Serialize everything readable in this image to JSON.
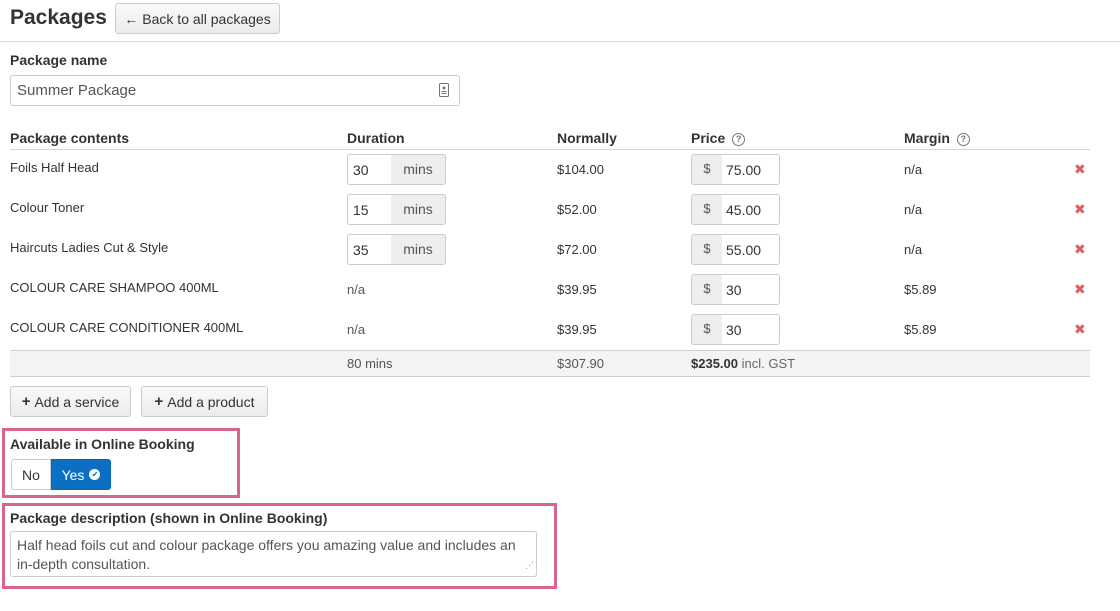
{
  "header": {
    "title": "Packages",
    "back_label": "Back to all packages"
  },
  "package_name": {
    "label": "Package name",
    "value": "Summer Package"
  },
  "table": {
    "headers": {
      "contents": "Package contents",
      "duration": "Duration",
      "normally": "Normally",
      "price": "Price",
      "margin": "Margin"
    },
    "rows": [
      {
        "name": "Foils Half Head",
        "duration": "30",
        "duration_unit": "mins",
        "normally": "$104.00",
        "currency": "$",
        "price": "75.00",
        "margin": "n/a"
      },
      {
        "name": "Colour Toner",
        "duration": "15",
        "duration_unit": "mins",
        "normally": "$52.00",
        "currency": "$",
        "price": "45.00",
        "margin": "n/a"
      },
      {
        "name": "Haircuts Ladies Cut & Style",
        "duration": "35",
        "duration_unit": "mins",
        "normally": "$72.00",
        "currency": "$",
        "price": "55.00",
        "margin": "n/a"
      },
      {
        "name": "COLOUR CARE SHAMPOO 400ML",
        "duration": "n/a",
        "normally": "$39.95",
        "currency": "$",
        "price": "30",
        "margin": "$5.89"
      },
      {
        "name": "COLOUR CARE CONDITIONER 400ML",
        "duration": "n/a",
        "normally": "$39.95",
        "currency": "$",
        "price": "30",
        "margin": "$5.89"
      }
    ],
    "totals": {
      "duration": "80 mins",
      "normally": "$307.90",
      "price": "$235.00",
      "price_suffix": "incl. GST"
    }
  },
  "actions": {
    "add_service": "Add a service",
    "add_product": "Add a product"
  },
  "online_booking": {
    "label": "Available in Online Booking",
    "no": "No",
    "yes": "Yes",
    "selected": "Yes"
  },
  "description": {
    "label": "Package description (shown in Online Booking)",
    "value": "Half head foils cut and colour package offers you amazing value and includes an in-depth consultation."
  },
  "icons": {
    "back": "arrow-left-icon",
    "help": "question-circle-icon",
    "remove": "times-icon",
    "add": "plus-icon",
    "check": "check-circle-icon",
    "field": "contact-card-icon"
  },
  "colors": {
    "primary": "#0b70c4",
    "remove": "#e05d5d",
    "highlight": "#d9658c"
  }
}
